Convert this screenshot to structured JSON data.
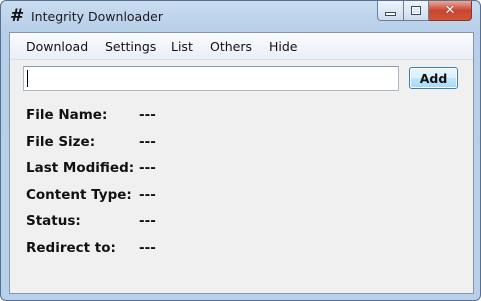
{
  "window": {
    "title": "Integrity Downloader",
    "icon_glyph": "#",
    "icon_name": "hash-icon"
  },
  "caption_buttons": {
    "minimize_icon": "minimize-icon",
    "maximize_icon": "maximize-icon",
    "close_icon": "close-icon",
    "close_glyph": "✕"
  },
  "menu": {
    "items": [
      "Download",
      "Settings",
      "List",
      "Others",
      "Hide"
    ]
  },
  "url_input": {
    "value": "",
    "placeholder": ""
  },
  "add_button": {
    "label": "Add"
  },
  "info": {
    "rows": [
      {
        "label": "File Name:",
        "value": "---"
      },
      {
        "label": "File Size:",
        "value": "---"
      },
      {
        "label": "Last Modified:",
        "value": "---"
      },
      {
        "label": "Content Type:",
        "value": "---"
      },
      {
        "label": "Status:",
        "value": "---"
      },
      {
        "label": "Redirect to:",
        "value": "---"
      }
    ]
  },
  "colors": {
    "window_frame": "#b9d0ea",
    "client_background": "#f0f0f0",
    "close_button": "#c8452f",
    "add_button_border": "#3c7fb1"
  }
}
